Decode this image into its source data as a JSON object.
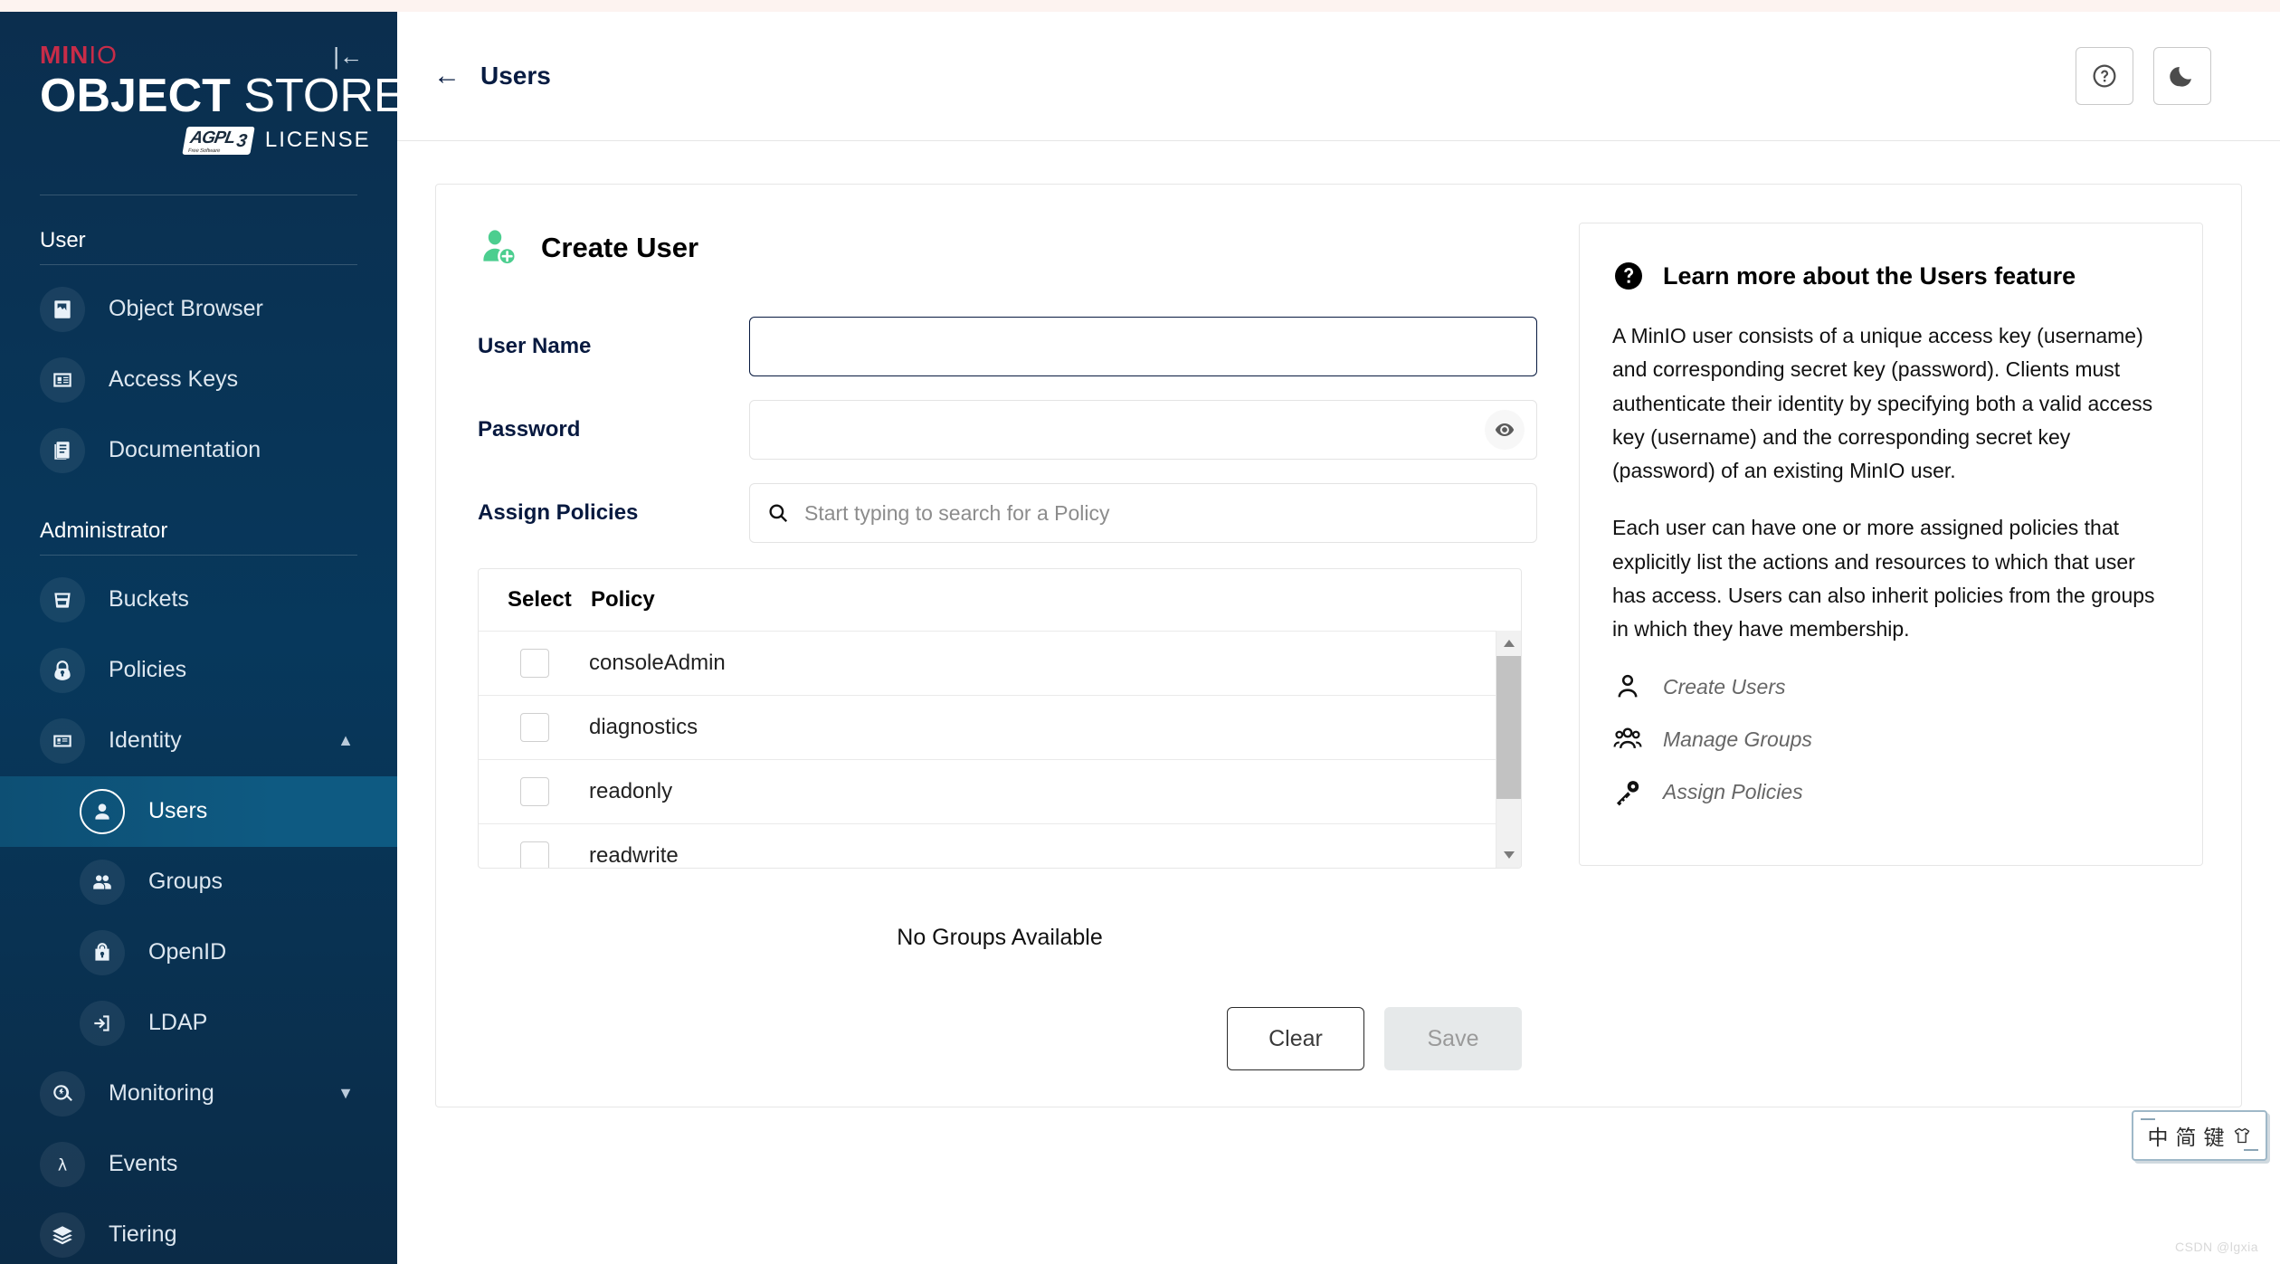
{
  "brand": {
    "minio": "MIN",
    "minio_io": "IO",
    "object": "OBJECT",
    "store": " STORE",
    "agpl_main": "AGPL",
    "agpl_sub": "Free Software",
    "agpl_ver": "3",
    "license": "LICENSE",
    "collapse_icon": "collapse-sidebar-icon"
  },
  "sidebar": {
    "sections": [
      {
        "title": "User",
        "items": [
          {
            "label": "Object Browser",
            "icon": "object-browser-icon",
            "active": false
          },
          {
            "label": "Access Keys",
            "icon": "access-keys-icon",
            "active": false
          },
          {
            "label": "Documentation",
            "icon": "documentation-icon",
            "active": false
          }
        ]
      },
      {
        "title": "Administrator",
        "items": [
          {
            "label": "Buckets",
            "icon": "buckets-icon",
            "active": false
          },
          {
            "label": "Policies",
            "icon": "policies-lock-icon",
            "active": false
          },
          {
            "label": "Identity",
            "icon": "identity-card-icon",
            "active": false,
            "expanded": true,
            "chevron": "chevron-up"
          },
          {
            "label": "Users",
            "icon": "user-icon",
            "active": true,
            "sub": true
          },
          {
            "label": "Groups",
            "icon": "groups-icon",
            "active": false,
            "sub": true
          },
          {
            "label": "OpenID",
            "icon": "openid-lock-icon",
            "active": false,
            "sub": true
          },
          {
            "label": "LDAP",
            "icon": "ldap-login-icon",
            "active": false,
            "sub": true
          },
          {
            "label": "Monitoring",
            "icon": "monitoring-icon",
            "active": false,
            "chevron": "chevron-down"
          },
          {
            "label": "Events",
            "icon": "events-lambda-icon",
            "active": false
          },
          {
            "label": "Tiering",
            "icon": "tiering-layers-icon",
            "active": false
          }
        ]
      }
    ]
  },
  "topbar": {
    "back_icon": "back-arrow-icon",
    "title": "Users",
    "help_icon": "help-circle-icon",
    "theme_icon": "dark-mode-moon-icon"
  },
  "form": {
    "header_icon": "add-user-icon",
    "header_title": "Create User",
    "fields": {
      "username_label": "User Name",
      "username_value": "",
      "username_placeholder": "",
      "password_label": "Password",
      "password_value": "",
      "password_placeholder": "",
      "password_toggle_icon": "eye-icon",
      "assign_policies_label": "Assign Policies",
      "assign_policies_placeholder": "Start typing to search for a Policy",
      "search_icon": "search-icon"
    },
    "policy_table": {
      "columns": [
        "Select",
        "Policy"
      ],
      "rows": [
        {
          "policy": "consoleAdmin",
          "selected": false
        },
        {
          "policy": "diagnostics",
          "selected": false
        },
        {
          "policy": "readonly",
          "selected": false
        },
        {
          "policy": "readwrite",
          "selected": false
        }
      ],
      "scrollbar": {
        "up_icon": "scroll-up-arrow",
        "down_icon": "scroll-down-arrow"
      }
    },
    "no_groups": "No Groups Available",
    "buttons": {
      "clear": "Clear",
      "save": "Save"
    }
  },
  "info": {
    "icon": "help-filled-icon",
    "title": "Learn more about the Users feature",
    "paragraphs": [
      "A MinIO user consists of a unique access key (username) and corresponding secret key (password). Clients must authenticate their identity by specifying both a valid access key (username) and the corresponding secret key (password) of an existing MinIO user.",
      "Each user can have one or more assigned policies that explicitly list the actions and resources to which that user has access. Users can also inherit policies from the groups in which they have membership."
    ],
    "links": [
      {
        "label": "Create Users",
        "icon": "single-user-icon"
      },
      {
        "label": "Manage Groups",
        "icon": "group-users-icon"
      },
      {
        "label": "Assign Policies",
        "icon": "key-icon"
      }
    ]
  },
  "ime": {
    "mode": "中",
    "script": "简",
    "keyboard": "键",
    "theme_icon": "shirt-theme-icon"
  },
  "watermark": "CSDN @lgxia",
  "colors": {
    "sidebar_bg": "#0b2e4e",
    "accent_red": "#c72c48",
    "active_item": "#0e5a82",
    "create_user_green": "#4cce8f",
    "title_navy": "#07193f"
  }
}
